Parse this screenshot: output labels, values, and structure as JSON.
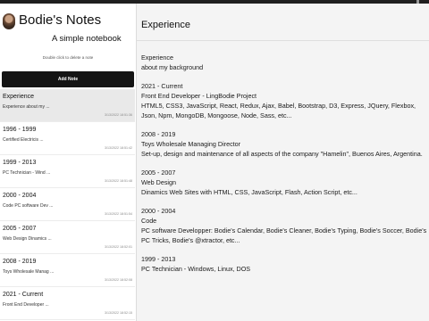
{
  "app": {
    "title": "Bodie's Notes",
    "subtitle": "A simple notebook",
    "hint": "Double click to delete a note",
    "add_label": "Add Note"
  },
  "notes": [
    {
      "title": "Experience",
      "preview": "Experience about my ...",
      "date": "3/13/2022 18:51:36",
      "active": true
    },
    {
      "title": "1996 - 1999",
      "preview": "Certified Electricis ...",
      "date": "3/13/2022 18:51:42",
      "active": false
    },
    {
      "title": "1999 - 2013",
      "preview": "PC Technician - Wind ...",
      "date": "3/13/2022 18:51:48",
      "active": false
    },
    {
      "title": "2000 - 2004",
      "preview": "Code PC software Dev ...",
      "date": "3/13/2022 18:51:54",
      "active": false
    },
    {
      "title": "2005 - 2007",
      "preview": "Web Design Dinamics ...",
      "date": "3/13/2022 18:52:01",
      "active": false
    },
    {
      "title": "2008 - 2019",
      "preview": "Toys Wholesale Manag ...",
      "date": "3/13/2022 18:52:08",
      "active": false
    },
    {
      "title": "2021 - Current",
      "preview": "Front End Developer ...",
      "date": "3/13/2022 18:52:15",
      "active": false
    }
  ],
  "editor": {
    "title": "Experience",
    "blocks": [
      [
        "Experience",
        "about my background"
      ],
      [
        "2021 - Current",
        "Front End Developer - LingBodie Project",
        "HTML5, CSS3, JavaScript, React, Redux, Ajax, Babel, Bootstrap, D3, Express, JQuery, Flexbox, Json, Npm, MongoDB, Mongoose, Node, Sass, etc..."
      ],
      [
        "2008 - 2019",
        "Toys Wholesale Managing Director",
        "Set-up, design and maintenance of all aspects of the company \"Hamelin\", Buenos Aires, Argentina."
      ],
      [
        "2005 - 2007",
        "Web Design",
        "Dinamics Web Sites with HTML, CSS, JavaScript, Flash, Action Script, etc..."
      ],
      [
        "2000 - 2004",
        "Code",
        "PC software Developper: Bodie's Calendar, Bodie's Cleaner, Bodie's Typing, Bodie's Soccer, Bodie's PC Tricks, Bodie's @xtractor, etc..."
      ],
      [
        "1999 - 2013",
        "PC Technician - Windows, Linux, DOS"
      ]
    ]
  }
}
